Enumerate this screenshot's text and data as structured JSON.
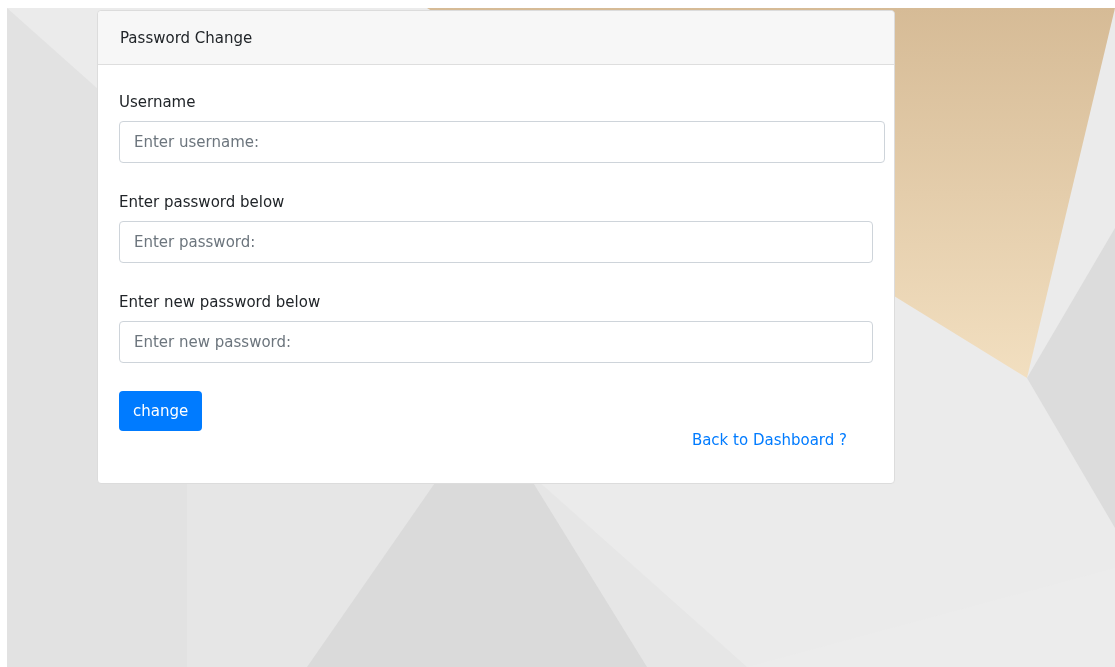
{
  "card": {
    "title": "Password Change",
    "fields": [
      {
        "label": "Username",
        "placeholder": "Enter username:",
        "kind": "wide"
      },
      {
        "label": "Enter password below",
        "placeholder": "Enter password:",
        "kind": "normal"
      },
      {
        "label": "Enter new password below",
        "placeholder": "Enter new password:",
        "kind": "normal"
      }
    ],
    "button": "change",
    "link": "Back to Dashboard ?"
  }
}
